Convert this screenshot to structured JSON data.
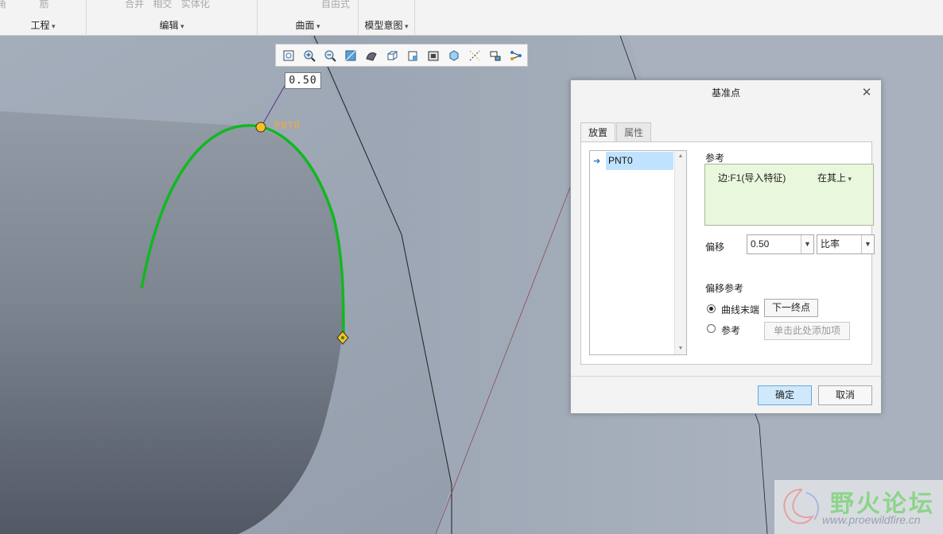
{
  "ribbon": {
    "groups": [
      {
        "label": "工程",
        "tools": [
          "角",
          "筋"
        ]
      },
      {
        "label": "编辑",
        "tools": [
          "合并",
          "相交",
          "实体化"
        ]
      },
      {
        "label": "曲面",
        "tools": [
          "自由式"
        ]
      },
      {
        "label": "模型意图",
        "tools": []
      }
    ]
  },
  "graphics_toolbar": {
    "icons": [
      "refit-icon",
      "zoom-in-icon",
      "zoom-out-icon",
      "repaint-icon",
      "display-style-icon",
      "saved-orientations-icon",
      "view-manager-icon",
      "perspective-view-icon",
      "spin-center-icon",
      "datum-display-icon",
      "annotation-display-icon",
      "point-display-icon"
    ]
  },
  "viewport": {
    "dimension_value": "0.50",
    "point_label": "PNT0",
    "curve_color": "#11b81f"
  },
  "dialog": {
    "title": "基准点",
    "tabs": [
      "放置",
      "属性"
    ],
    "list_items": [
      "PNT0"
    ],
    "reference": {
      "label": "参考",
      "item": "边:F1(导入特征)",
      "mode": "在其上"
    },
    "offset": {
      "label": "偏移",
      "value": "0.50",
      "type": "比率"
    },
    "offset_reference": {
      "label": "偏移参考",
      "option_curve_end": "曲线末端",
      "curve_end_button": "下一终点",
      "option_reference": "参考",
      "reference_placeholder": "单击此处添加项"
    },
    "ok": "确定",
    "cancel": "取消"
  },
  "watermark": {
    "name": "野火论坛",
    "url": "www.proewildfire.cn"
  }
}
